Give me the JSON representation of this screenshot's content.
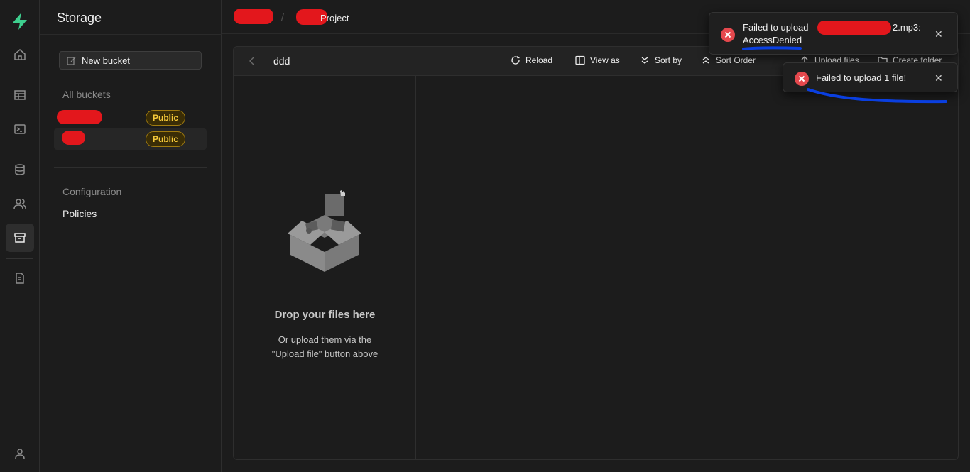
{
  "sidebar": {
    "title": "Storage",
    "new_bucket_label": "New bucket",
    "all_buckets_label": "All buckets",
    "buckets": [
      {
        "badge": "Public"
      },
      {
        "badge": "Public"
      }
    ],
    "configuration_label": "Configuration",
    "policies_label": "Policies"
  },
  "header": {
    "separator": "/",
    "project_suffix": "Project"
  },
  "explorer": {
    "folder_name": "ddd",
    "toolbar": {
      "reload": "Reload",
      "view_as": "View as",
      "sort_by": "Sort by",
      "sort_order": "Sort Order",
      "upload_files": "Upload files",
      "create_folder": "Create folder"
    },
    "dropzone": {
      "title": "Drop your files here",
      "subtitle": "Or upload them via the \"Upload file\" button above"
    }
  },
  "toasts": [
    {
      "message_prefix": "Failed to upload",
      "message_suffix": "2.mp3:",
      "message_line2": "AccessDenied",
      "close": "✕"
    },
    {
      "message": "Failed to upload 1 file!",
      "close": "✕"
    }
  ],
  "colors": {
    "brand": "#3ecf8e",
    "error": "#e5484d",
    "badge_text": "#f5c93a",
    "annotation_blue": "#0a3fe0",
    "redaction": "#e3171c"
  },
  "icons": {
    "rail": [
      "supabase-logo-icon",
      "home-icon",
      "table-icon",
      "terminal-icon",
      "database-icon",
      "users-icon",
      "storage-icon",
      "document-icon",
      "user-icon"
    ]
  }
}
